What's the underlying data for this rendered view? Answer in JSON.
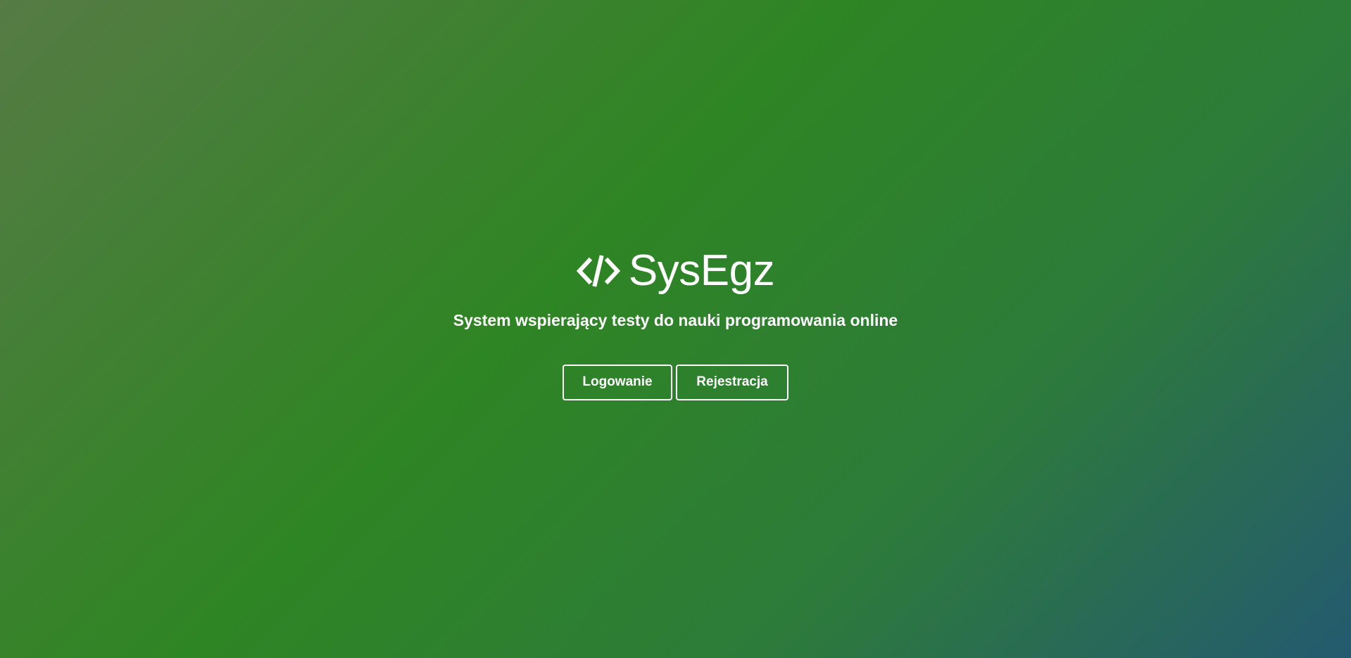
{
  "brand": {
    "icon": "code-icon",
    "name": "SysEgz"
  },
  "hero": {
    "subtitle": "System wspierający testy do nauki programowania online"
  },
  "actions": {
    "login_label": "Logowanie",
    "register_label": "Rejestracja"
  },
  "colors": {
    "text": "#ffffff",
    "gradient_start": "#567b45",
    "gradient_mid": "#2e8523",
    "gradient_end": "#245a70"
  }
}
